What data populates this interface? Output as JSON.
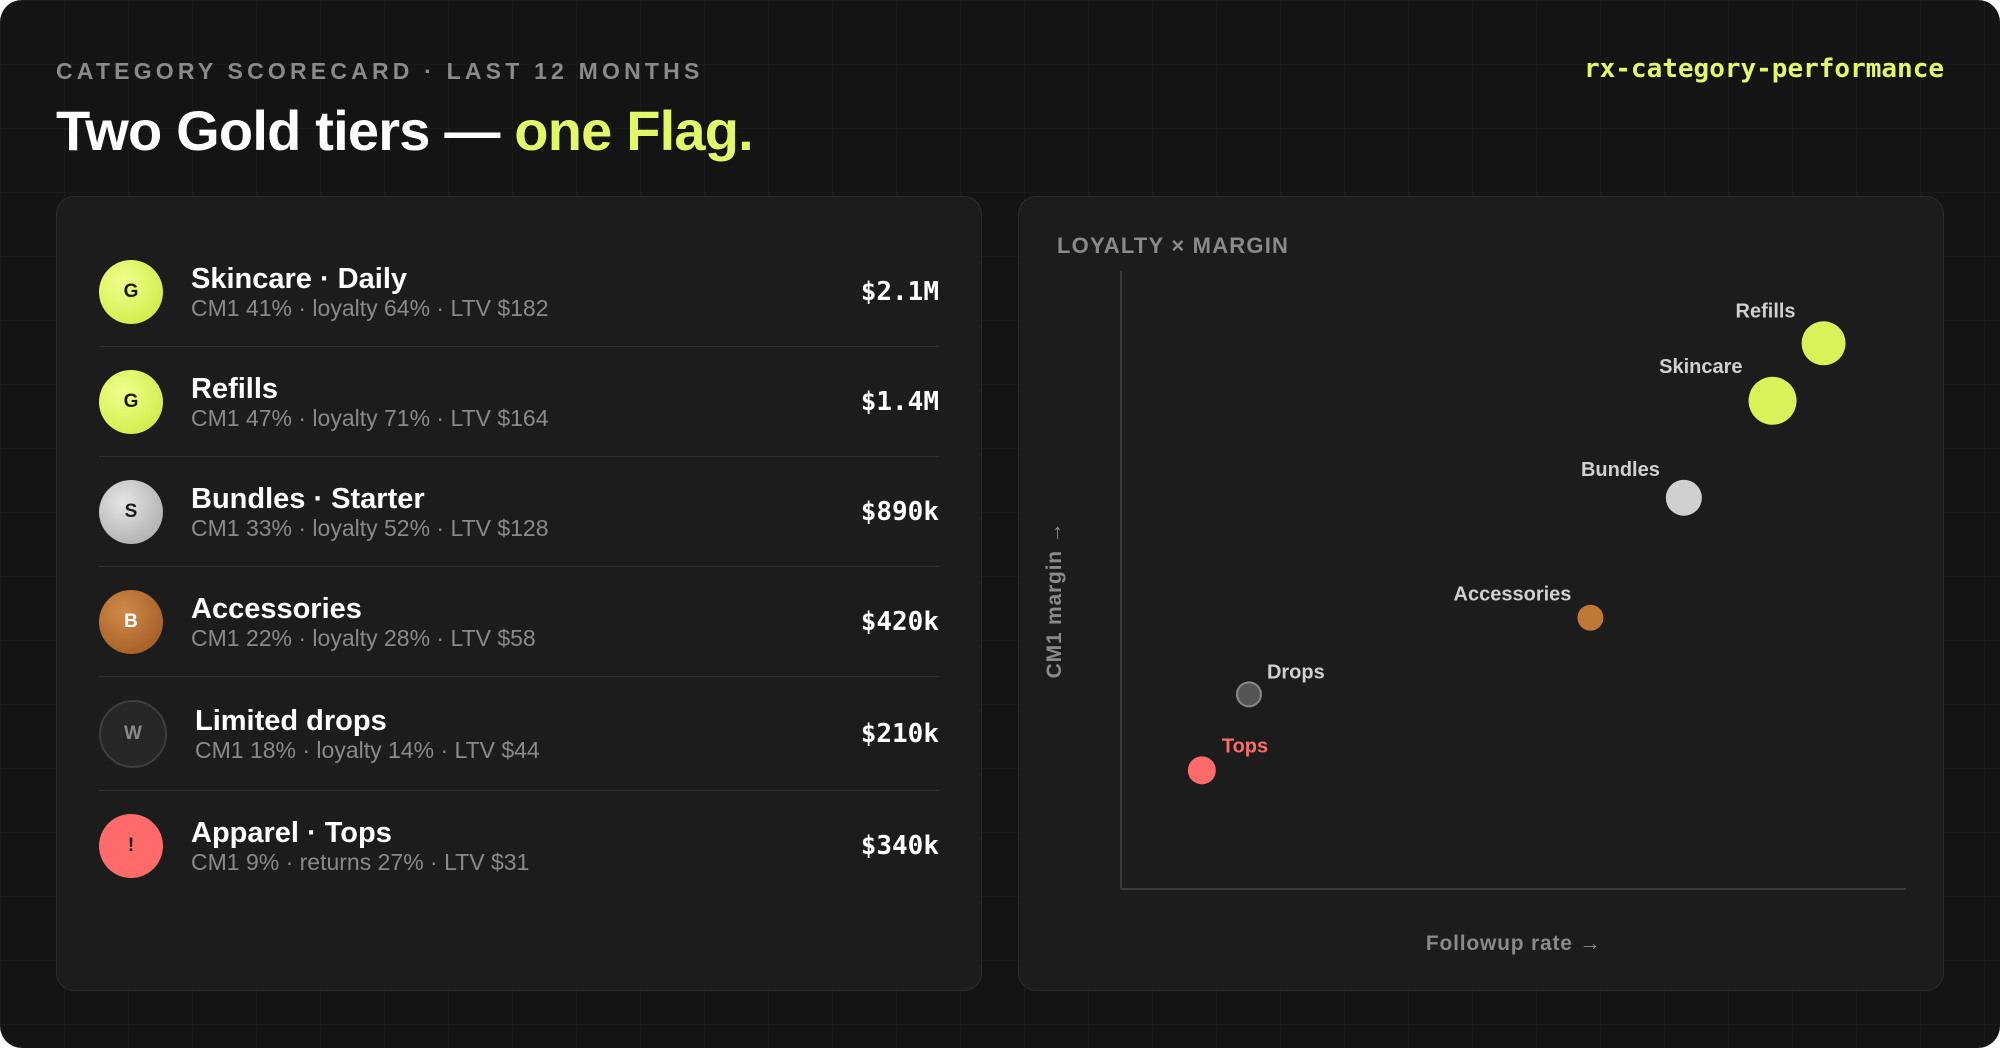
{
  "header": {
    "eyebrow": "CATEGORY SCORECARD · LAST 12 MONTHS",
    "title_main": "Two Gold tiers — ",
    "title_accent": "one Flag.",
    "slug": "rx-category-performance"
  },
  "colors": {
    "background": "#141414",
    "panel": "#1c1c1c",
    "accent": "#e2f86a",
    "gold": "#d9f25a",
    "silver": "#c4c4c4",
    "bronze": "#b36b30",
    "watch": "#555555",
    "flag": "#ff6b6b",
    "muted": "#8a8a8a"
  },
  "scorecard": {
    "rows": [
      {
        "badge": "G",
        "tier": "gold",
        "name": "Skincare · Daily",
        "meta": "CM1 41% · loyalty 64% · LTV $182",
        "value": "$2.1M"
      },
      {
        "badge": "G",
        "tier": "gold",
        "name": "Refills",
        "meta": "CM1 47% · loyalty 71% · LTV $164",
        "value": "$1.4M"
      },
      {
        "badge": "S",
        "tier": "silver",
        "name": "Bundles · Starter",
        "meta": "CM1 33% · loyalty 52% · LTV $128",
        "value": "$890k"
      },
      {
        "badge": "B",
        "tier": "bronze",
        "name": "Accessories",
        "meta": "CM1 22% · loyalty 28% · LTV $58",
        "value": "$420k"
      },
      {
        "badge": "W",
        "tier": "watch",
        "name": "Limited drops",
        "meta": "CM1 18% · loyalty 14% · LTV $44",
        "value": "$210k"
      },
      {
        "badge": "!",
        "tier": "flag",
        "name": "Apparel · Tops",
        "meta": "CM1 9% · returns 27% · LTV $31",
        "value": "$340k"
      }
    ]
  },
  "chart": {
    "title": "LOYALTY × MARGIN"
  },
  "chart_data": {
    "type": "scatter",
    "title": "LOYALTY × MARGIN",
    "xlabel": "Followup rate →",
    "ylabel": "CM1 margin →",
    "grid": false,
    "legend": "none",
    "xlim": [
      0,
      100
    ],
    "ylim": [
      0,
      100
    ],
    "points": [
      {
        "label": "Refills",
        "x": 89.5,
        "y": 88.3,
        "size": 22,
        "color": "#d9f25a",
        "label_color": "#d0d0d0",
        "label_side": "left"
      },
      {
        "label": "Skincare",
        "x": 83,
        "y": 79,
        "size": 24,
        "color": "#d9f25a",
        "label_color": "#d0d0d0",
        "label_side": "left"
      },
      {
        "label": "Bundles",
        "x": 71.7,
        "y": 63.3,
        "size": 18,
        "color": "#d0d0d0",
        "label_color": "#d0d0d0",
        "label_side": "left"
      },
      {
        "label": "Accessories",
        "x": 59.8,
        "y": 43.9,
        "size": 13,
        "color": "#c07838",
        "label_color": "#d0d0d0",
        "label_side": "left"
      },
      {
        "label": "Drops",
        "x": 16.3,
        "y": 31.5,
        "size": 12,
        "color": "#555555",
        "label_color": "#d0d0d0",
        "label_side": "right"
      },
      {
        "label": "Tops",
        "x": 10.3,
        "y": 19.2,
        "size": 14,
        "color": "#ff6b6b",
        "label_color": "#ff6b6b",
        "label_side": "right"
      }
    ]
  }
}
